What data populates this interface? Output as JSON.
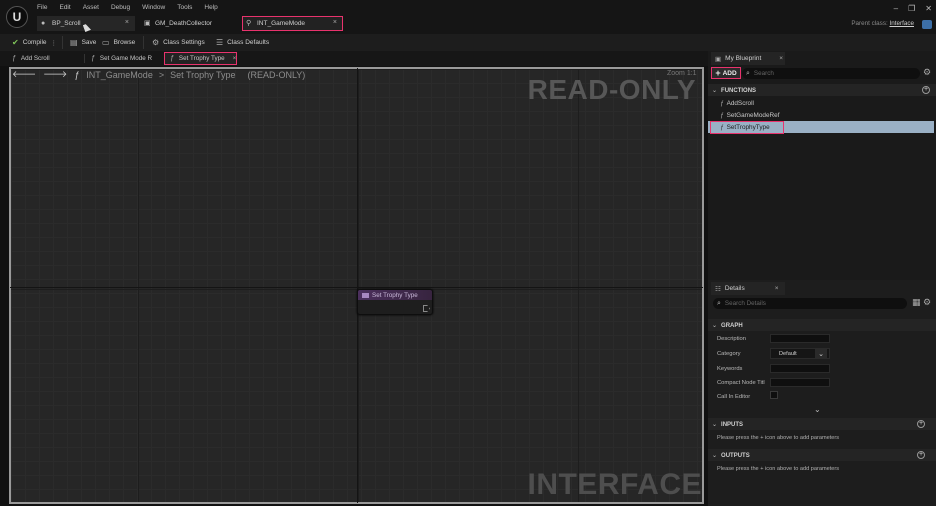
{
  "menu": [
    "File",
    "Edit",
    "Asset",
    "Debug",
    "Window",
    "Tools",
    "Help"
  ],
  "doc_tabs": [
    {
      "label": "BP_Scroll",
      "close": "×"
    },
    {
      "label": "GM_DeathCollector"
    },
    {
      "label": "INT_GameMode",
      "close": "×"
    }
  ],
  "parent_class": {
    "label": "Parent class:",
    "value": "Interface"
  },
  "window_controls": {
    "minimize": "–",
    "maximize": "❐",
    "close": "✕"
  },
  "toolbar": {
    "compile": "Compile",
    "save": "Save",
    "browse": "Browse",
    "class_settings": "Class Settings",
    "class_defaults": "Class Defaults"
  },
  "graph_tabs": [
    {
      "label": "Add Scroll"
    },
    {
      "label": "Set Game Mode R"
    },
    {
      "label": "Set Trophy Type",
      "close": "×"
    }
  ],
  "breadcrumb": {
    "root": "INT_GameMode",
    "separator": ">",
    "current": "Set Trophy Type",
    "status": "(READ-ONLY)"
  },
  "zoom": "Zoom 1:1",
  "watermarks": {
    "readonly": "READ-ONLY",
    "interface": "INTERFACE"
  },
  "node": {
    "title": "Set Trophy Type"
  },
  "my_blueprint": {
    "tab": "My Blueprint",
    "close": "×",
    "add_label": "ADD",
    "search_placeholder": "Search",
    "functions_header": "FUNCTIONS",
    "functions": [
      "AddScroll",
      "SetGameModeRef",
      "SetTrophyType"
    ],
    "selected_function": "SetTrophyType"
  },
  "details": {
    "tab": "Details",
    "close": "×",
    "search_placeholder": "Search Details",
    "graph_header": "GRAPH",
    "labels": {
      "description": "Description",
      "category": "Category",
      "keywords": "Keywords",
      "compact_node_title": "Compact Node Titl",
      "call_in_editor": "Call In Editor"
    },
    "category_value": "Default",
    "inputs_header": "INPUTS",
    "inputs_hint": "Please press the + icon above to add parameters",
    "outputs_header": "OUTPUTS",
    "outputs_hint": "Please press the + icon above to add parameters"
  },
  "colors": {
    "highlight": "#e8336d",
    "selection": "#9ab0c5",
    "node_header": "#4b2f5c"
  }
}
